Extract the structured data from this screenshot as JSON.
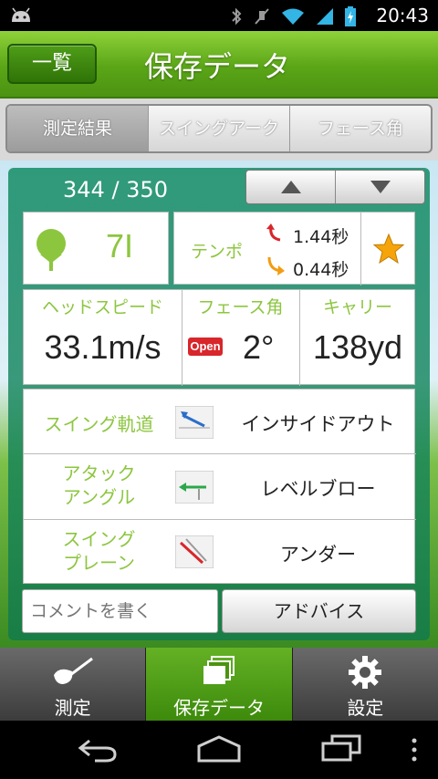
{
  "status": {
    "time": "20:43"
  },
  "header": {
    "back_label": "一覧",
    "title": "保存データ"
  },
  "tabs": [
    {
      "label": "測定結果",
      "active": true
    },
    {
      "label": "スイングアーク",
      "active": false
    },
    {
      "label": "フェース角",
      "active": false
    }
  ],
  "record": {
    "counter": "344 / 350"
  },
  "club": {
    "name": "7I"
  },
  "tempo": {
    "label": "テンポ",
    "back": "1.44秒",
    "down": "0.44秒"
  },
  "metrics": [
    {
      "label": "ヘッドスピード",
      "value": "33.1m/s"
    },
    {
      "label": "フェース角",
      "badge": "Open",
      "value": "2°"
    },
    {
      "label": "キャリー",
      "value": "138yd"
    }
  ],
  "details": [
    {
      "label": "スイング軌道",
      "value": "インサイドアウト"
    },
    {
      "label_line1": "アタック",
      "label_line2": "アングル",
      "value": "レベルブロー"
    },
    {
      "label_line1": "スイング",
      "label_line2": "プレーン",
      "value": "アンダー"
    }
  ],
  "comment": {
    "placeholder": "コメントを書く"
  },
  "advice_button": "アドバイス",
  "bottom_nav": [
    {
      "label": "測定",
      "icon": "golf-club-icon",
      "active": false
    },
    {
      "label": "保存データ",
      "icon": "saved-data-icon",
      "active": true
    },
    {
      "label": "設定",
      "icon": "gear-icon",
      "active": false
    }
  ],
  "colors": {
    "accent_green": "#8cc63f",
    "header_green": "#5aa517",
    "open_badge": "#d8262b",
    "star": "#f5a40b"
  }
}
